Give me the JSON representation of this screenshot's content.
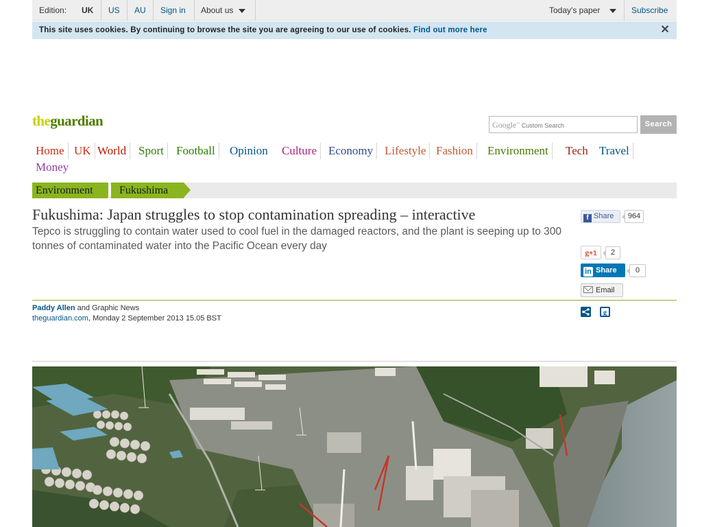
{
  "topbar": {
    "edition_label": "Edition:",
    "editions": [
      "UK",
      "US",
      "AU"
    ],
    "sign_in": "Sign in",
    "about": "About us",
    "todays_paper": "Today's paper",
    "subscribe": "Subscribe"
  },
  "cookie": {
    "message": "This site uses cookies. By continuing to browse the site you are agreeing to our use of cookies.",
    "link": "Find out more here",
    "close": "✕"
  },
  "logo": {
    "the": "the",
    "guardian": "guardian"
  },
  "search": {
    "google": "Google",
    "placeholder": "Custom Search",
    "button": "Search"
  },
  "nav": {
    "items": [
      {
        "label": "Home",
        "color": "#cc2b12"
      },
      {
        "label": "UK",
        "color": "#cc2b12"
      },
      {
        "label": "World",
        "color": "#b51800"
      },
      {
        "label": "Sport",
        "color": "#2b7c00"
      },
      {
        "label": "Football",
        "color": "#2b7c00"
      },
      {
        "label": "Opinion",
        "color": "#005689"
      },
      {
        "label": "Culture",
        "color": "#b0217c"
      },
      {
        "label": "Economy",
        "color": "#2f4d8a"
      },
      {
        "label": "Lifestyle",
        "color": "#c05a32"
      },
      {
        "label": "Fashion",
        "color": "#c05a32"
      },
      {
        "label": "Environment",
        "color": "#4a7a00"
      },
      {
        "label": "Tech",
        "color": "#a0240f"
      },
      {
        "label": "Travel",
        "color": "#005689"
      },
      {
        "label": "Money",
        "color": "#8d3fa5"
      }
    ]
  },
  "breadcrumb": [
    "Environment",
    "Fukushima"
  ],
  "article": {
    "headline": "Fukushima: Japan struggles to stop contamination spreading – interactive",
    "standfirst": "Tepco is struggling to contain water used to cool fuel in the damaged reactors, and the plant is seeping up to 300 tonnes of contaminated water into the Pacific Ocean every day",
    "author": "Paddy Allen",
    "coauthor": " and Graphic News",
    "site": "theguardian.com",
    "date": ", Monday 2 September 2013 15.05 BST"
  },
  "share": {
    "fb_label": "Share",
    "fb_count": "964",
    "gplus_label": "+1",
    "gplus_count": "2",
    "linkedin_label": "Share",
    "linkedin_count": "0",
    "email_label": "Email"
  }
}
